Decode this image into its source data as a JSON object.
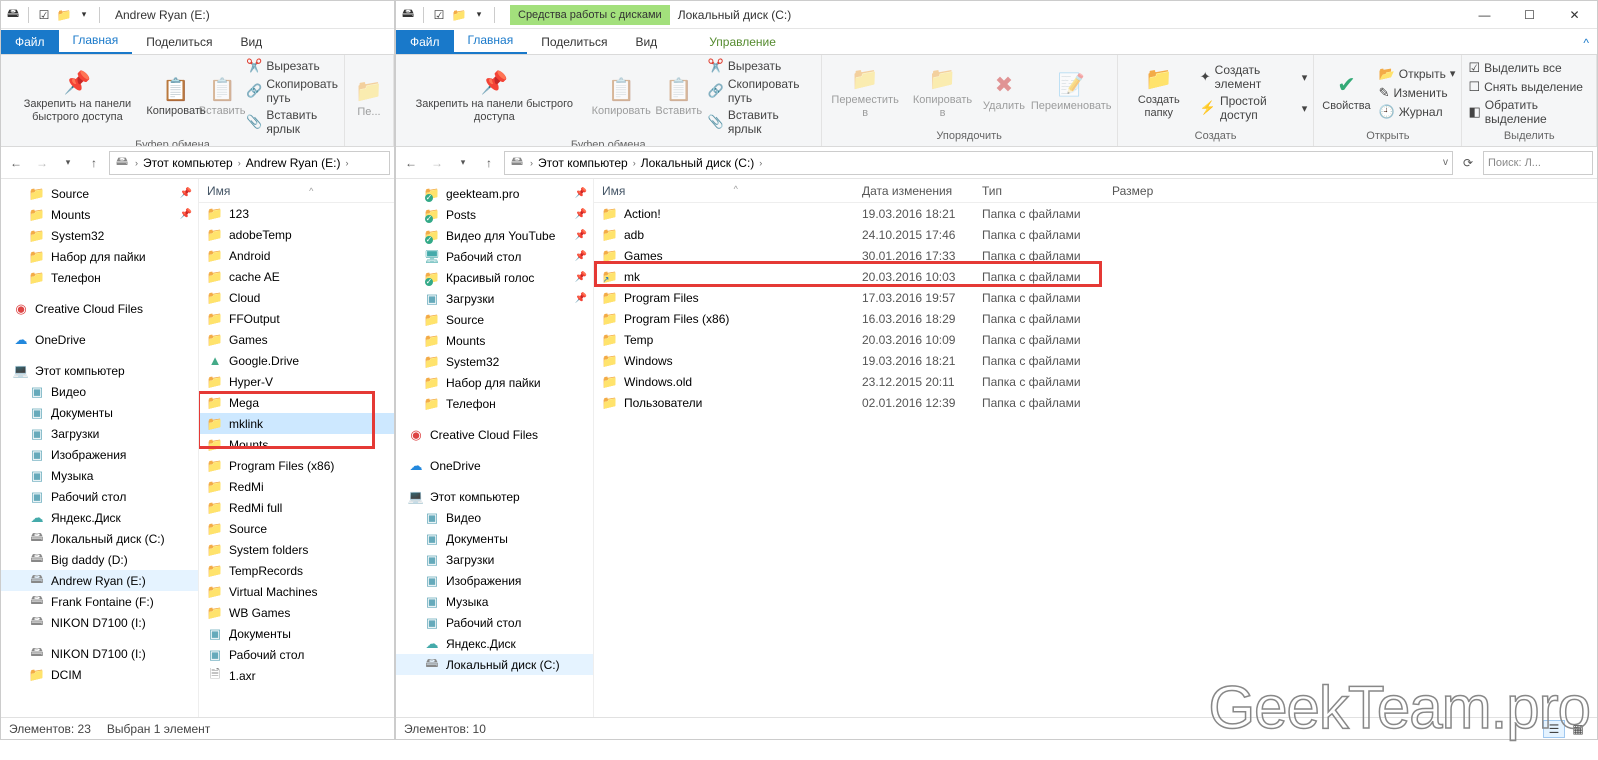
{
  "winL": {
    "title": "Andrew Ryan (E:)",
    "tabs": {
      "file": "Файл",
      "home": "Главная",
      "share": "Поделиться",
      "view": "Вид"
    },
    "ribbon": {
      "pin": "Закрепить на панели\nбыстрого доступа",
      "copy": "Копировать",
      "paste": "Вставить",
      "cut": "Вырезать",
      "copypath": "Скопировать путь",
      "pastelink": "Вставить ярлык",
      "grp_clip": "Буфер обмена",
      "move": "Пе..."
    },
    "breadcrumb": [
      "Этот компьютер",
      "Andrew Ryan (E:)"
    ],
    "nav": {
      "quick": [
        {
          "n": "Source",
          "ico": "folder",
          "pin": true
        },
        {
          "n": "Mounts",
          "ico": "folder",
          "pin": true
        },
        {
          "n": "System32",
          "ico": "folder"
        },
        {
          "n": "Набор для пайки",
          "ico": "folder"
        },
        {
          "n": "Телефон",
          "ico": "folder"
        }
      ],
      "ccf": "Creative Cloud Files",
      "onedrive": "OneDrive",
      "thispc": "Этот компьютер",
      "pcitems": [
        {
          "n": "Видео",
          "ico": "lib"
        },
        {
          "n": "Документы",
          "ico": "lib"
        },
        {
          "n": "Загрузки",
          "ico": "lib"
        },
        {
          "n": "Изображения",
          "ico": "lib"
        },
        {
          "n": "Музыка",
          "ico": "lib"
        },
        {
          "n": "Рабочий стол",
          "ico": "lib"
        },
        {
          "n": "Яндекс.Диск",
          "ico": "ydisk"
        },
        {
          "n": "Локальный диск (C:)",
          "ico": "disk"
        },
        {
          "n": "Big daddy (D:)",
          "ico": "disk"
        },
        {
          "n": "Andrew Ryan (E:)",
          "ico": "disk",
          "sel": true
        },
        {
          "n": "Frank Fontaine (F:)",
          "ico": "disk"
        },
        {
          "n": "NIKON D7100 (I:)",
          "ico": "disk"
        }
      ],
      "extra": [
        {
          "n": "NIKON D7100 (I:)",
          "ico": "disk"
        },
        {
          "n": "DCIM",
          "ico": "folder"
        }
      ]
    },
    "listHeader": {
      "name": "Имя"
    },
    "items": [
      {
        "n": "123"
      },
      {
        "n": "adobeTemp"
      },
      {
        "n": "Android"
      },
      {
        "n": "cache AE"
      },
      {
        "n": "Cloud"
      },
      {
        "n": "FFOutput"
      },
      {
        "n": "Games"
      },
      {
        "n": "Google.Drive",
        "ico": "gdrive"
      },
      {
        "n": "Hyper-V"
      },
      {
        "n": "Mega"
      },
      {
        "n": "mklink",
        "sel": true
      },
      {
        "n": "Mounts"
      },
      {
        "n": "Program Files (x86)"
      },
      {
        "n": "RedMi"
      },
      {
        "n": "RedMi full"
      },
      {
        "n": "Source"
      },
      {
        "n": "System folders"
      },
      {
        "n": "TempRecords"
      },
      {
        "n": "Virtual Machines"
      },
      {
        "n": "WB Games"
      },
      {
        "n": "Документы",
        "ico": "lib"
      },
      {
        "n": "Рабочий стол",
        "ico": "lib"
      },
      {
        "n": "1.axr",
        "ico": "file"
      }
    ],
    "status": {
      "count": "Элементов: 23",
      "sel": "Выбран 1 элемент"
    }
  },
  "winR": {
    "titleCtx": "Средства работы с дисками",
    "title": "Локальный диск (C:)",
    "tabs": {
      "file": "Файл",
      "home": "Главная",
      "share": "Поделиться",
      "view": "Вид",
      "manage": "Управление"
    },
    "ribbon": {
      "pin": "Закрепить на панели\nбыстрого доступа",
      "copy": "Копировать",
      "paste": "Вставить",
      "cut": "Вырезать",
      "copypath": "Скопировать путь",
      "pastelink": "Вставить ярлык",
      "grp_clip": "Буфер обмена",
      "move": "Переместить\nв",
      "copyto": "Копировать\nв",
      "delete": "Удалить",
      "rename": "Переименовать",
      "grp_org": "Упорядочить",
      "newfolder": "Создать\nпапку",
      "newitem": "Создать элемент",
      "easyaccess": "Простой доступ",
      "grp_new": "Создать",
      "props": "Свойства",
      "open": "Открыть",
      "edit": "Изменить",
      "history": "Журнал",
      "grp_open": "Открыть",
      "selall": "Выделить все",
      "selnone": "Снять выделение",
      "selinv": "Обратить выделение",
      "grp_sel": "Выделить"
    },
    "breadcrumb": [
      "Этот компьютер",
      "Локальный диск (C:)"
    ],
    "search": "Поиск: Л...",
    "nav": {
      "quick": [
        {
          "n": "geekteam.pro",
          "ico": "folder",
          "pin": true,
          "badge": "g"
        },
        {
          "n": "Posts",
          "ico": "folder",
          "pin": true,
          "badge": "g"
        },
        {
          "n": "Видео для YouTube",
          "ico": "folder",
          "pin": true,
          "badge": "g"
        },
        {
          "n": "Рабочий стол",
          "ico": "desktop",
          "pin": true
        },
        {
          "n": "Красивый голос",
          "ico": "folder",
          "pin": true,
          "badge": "g"
        },
        {
          "n": "Загрузки",
          "ico": "lib",
          "pin": true
        },
        {
          "n": "Source",
          "ico": "folder"
        },
        {
          "n": "Mounts",
          "ico": "folder"
        },
        {
          "n": "System32",
          "ico": "folder"
        },
        {
          "n": "Набор для пайки",
          "ico": "folder"
        },
        {
          "n": "Телефон",
          "ico": "folder"
        }
      ],
      "ccf": "Creative Cloud Files",
      "onedrive": "OneDrive",
      "thispc": "Этот компьютер",
      "pcitems": [
        {
          "n": "Видео",
          "ico": "lib"
        },
        {
          "n": "Документы",
          "ico": "lib"
        },
        {
          "n": "Загрузки",
          "ico": "lib"
        },
        {
          "n": "Изображения",
          "ico": "lib"
        },
        {
          "n": "Музыка",
          "ico": "lib"
        },
        {
          "n": "Рабочий стол",
          "ico": "lib"
        },
        {
          "n": "Яндекс.Диск",
          "ico": "ydisk"
        },
        {
          "n": "Локальный диск (C:)",
          "ico": "disk",
          "sel": true
        }
      ]
    },
    "listHeader": {
      "name": "Имя",
      "date": "Дата изменения",
      "type": "Тип",
      "size": "Размер"
    },
    "items": [
      {
        "n": "Action!",
        "d": "19.03.2016 18:21",
        "t": "Папка с файлами"
      },
      {
        "n": "adb",
        "d": "24.10.2015 17:46",
        "t": "Папка с файлами"
      },
      {
        "n": "Games",
        "d": "30.01.2016 17:33",
        "t": "Папка с файлами"
      },
      {
        "n": "mk",
        "d": "20.03.2016 10:03",
        "t": "Папка с файлами",
        "link": true,
        "hi": true
      },
      {
        "n": "Program Files",
        "d": "17.03.2016 19:57",
        "t": "Папка с файлами"
      },
      {
        "n": "Program Files (x86)",
        "d": "16.03.2016 18:29",
        "t": "Папка с файлами"
      },
      {
        "n": "Temp",
        "d": "20.03.2016 10:09",
        "t": "Папка с файлами"
      },
      {
        "n": "Windows",
        "d": "19.03.2016 18:21",
        "t": "Папка с файлами"
      },
      {
        "n": "Windows.old",
        "d": "23.12.2015 20:11",
        "t": "Папка с файлами"
      },
      {
        "n": "Пользователи",
        "d": "02.01.2016 12:39",
        "t": "Папка с файлами"
      }
    ],
    "status": {
      "count": "Элементов: 10"
    }
  },
  "watermark": "GeekTeam.pro"
}
